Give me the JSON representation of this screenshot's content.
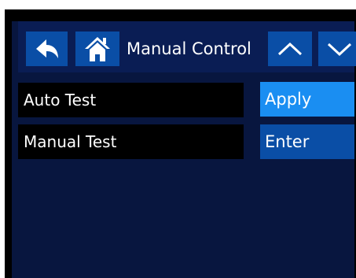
{
  "header": {
    "title": "Manual Control",
    "back_icon": "back-arrow-icon",
    "home_icon": "home-icon",
    "up_icon": "chevron-up-icon",
    "down_icon": "chevron-down-icon"
  },
  "rows": [
    {
      "label": "Auto Test",
      "action": "Apply"
    },
    {
      "label": "Manual Test",
      "action": "Enter"
    }
  ],
  "colors": {
    "panel_bg": "#08163f",
    "button_blue": "#0a4ea6",
    "highlight_blue": "#1a8ef2",
    "row_bg": "#000000",
    "text": "#ffffff"
  }
}
